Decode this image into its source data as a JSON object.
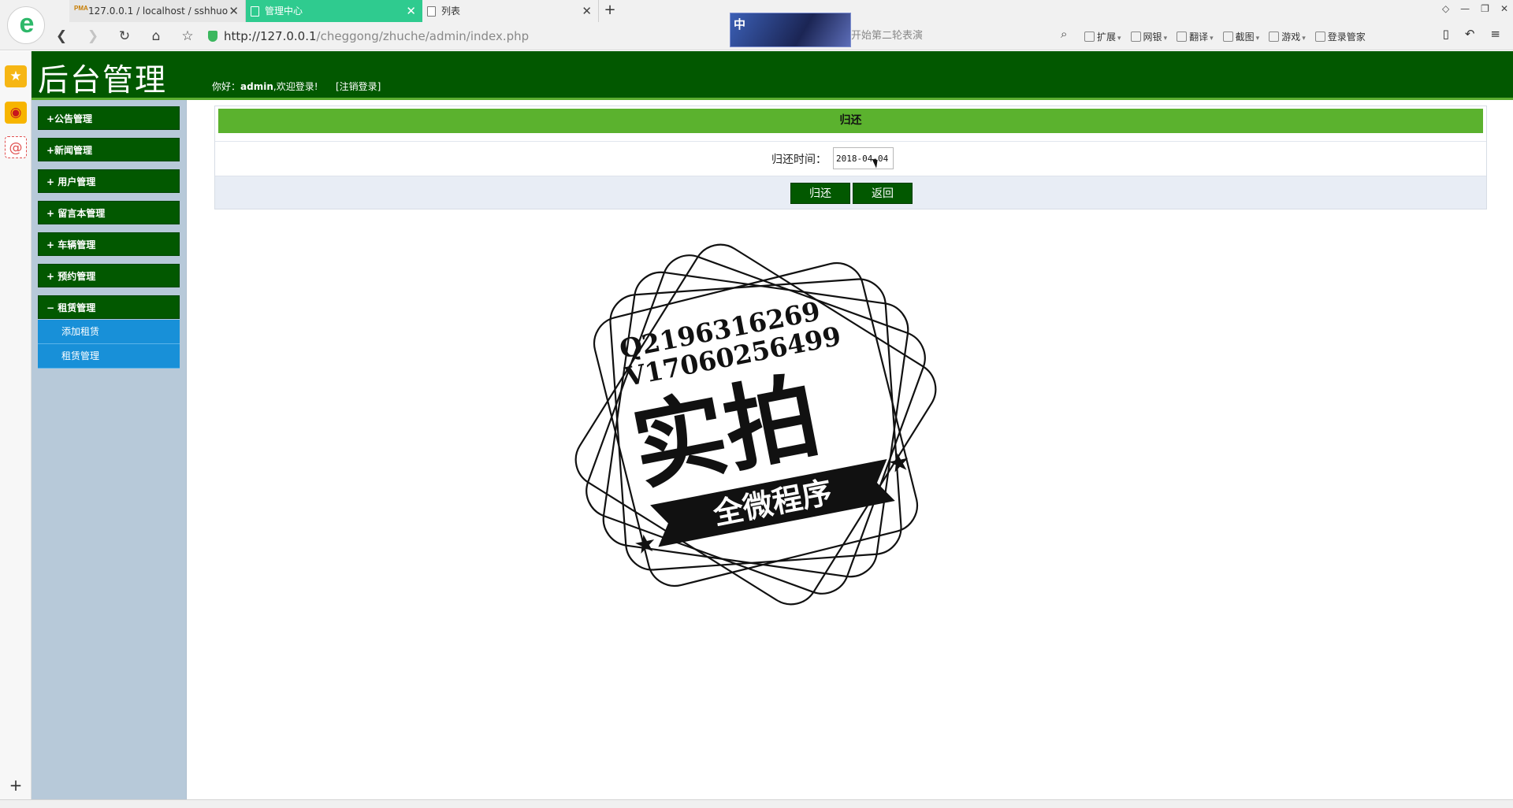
{
  "browser": {
    "tabs": [
      {
        "title": "127.0.0.1 / localhost / sshhuo",
        "icon": "phpmyadmin-icon",
        "icon_text": "PMA",
        "close": "✕"
      },
      {
        "title": "管理中心",
        "icon": "page-icon",
        "close": "✕"
      },
      {
        "title": "列表",
        "icon": "page-icon",
        "close": "✕"
      }
    ],
    "new_tab": "+",
    "address": {
      "host": "http://127.0.0.1",
      "path": "/cheggong/zhuche/admin/index.php"
    },
    "ad_badge": "中",
    "search_placeholder": "开始第二轮表演",
    "toolbar": [
      {
        "label": "扩展",
        "icon": "extension-icon"
      },
      {
        "label": "网银",
        "icon": "bank-icon"
      },
      {
        "label": "翻译",
        "icon": "translate-icon"
      },
      {
        "label": "截图",
        "icon": "screenshot-icon"
      },
      {
        "label": "游戏",
        "icon": "game-icon"
      },
      {
        "label": "登录管家",
        "icon": "login-manager-icon"
      }
    ]
  },
  "header": {
    "title": "后台管理",
    "welcome_prefix": "你好：",
    "username": "admin",
    "welcome_suffix": ",欢迎登录!",
    "logout": "[注销登录]"
  },
  "sidebar": {
    "items": [
      {
        "label": "+公告管理"
      },
      {
        "label": "+新闻管理"
      },
      {
        "label": "+ 用户管理"
      },
      {
        "label": "+ 留言本管理"
      },
      {
        "label": "+ 车辆管理"
      },
      {
        "label": "+ 预约管理"
      },
      {
        "label": "− 租赁管理",
        "expanded": true
      }
    ],
    "submenu": [
      {
        "label": "添加租赁"
      },
      {
        "label": "租赁管理"
      }
    ]
  },
  "form": {
    "title": "归还",
    "field_label": "归还时间：",
    "field_value": "2018-04-04",
    "submit_label": "归还",
    "back_label": "返回"
  },
  "watermark": {
    "line1": "Q2196316269",
    "line2": "V17060256499",
    "main": "实拍",
    "ribbon": "全微程序"
  },
  "colors": {
    "header_bg": "#025800",
    "title_bar": "#5bb22e",
    "submenu_bg": "#1890d8",
    "sidebar_bg": "#b7c9d9",
    "active_tab": "#2fcb8f"
  }
}
